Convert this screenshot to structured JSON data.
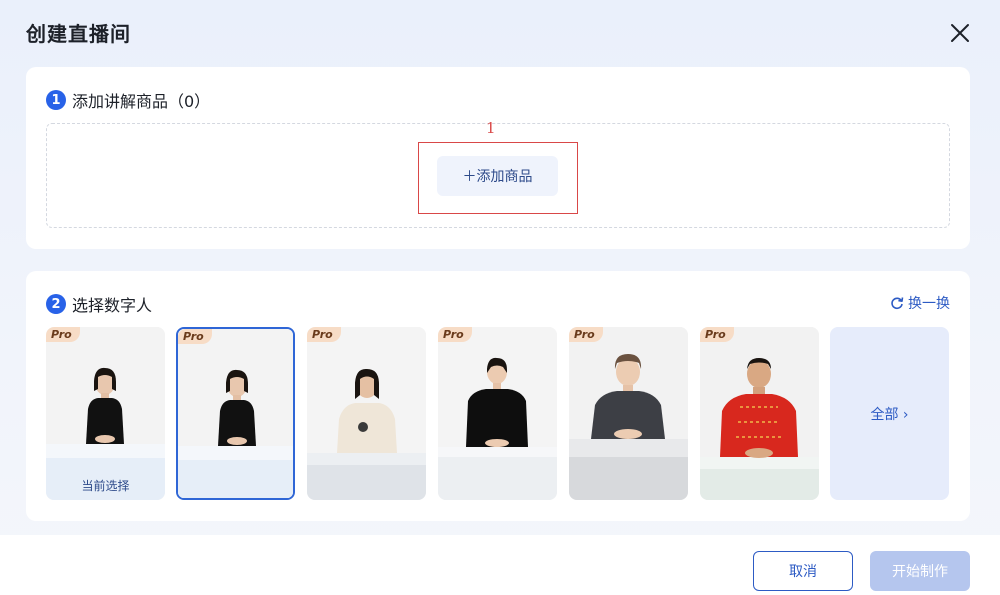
{
  "dialog": {
    "title": "创建直播间",
    "close_icon": "close-icon"
  },
  "section1": {
    "number": "1",
    "title": "添加讲解商品（0）",
    "add_button": "＋添加商品",
    "annotation_number": "1",
    "annotation_color": "#d94848"
  },
  "section2": {
    "number": "2",
    "title": "选择数字人",
    "swap_label": "换一换",
    "swap_icon": "refresh-icon",
    "all_label": "全部 ›",
    "avatars": [
      {
        "badge": "Pro",
        "caption": "当前选择",
        "outfit": "black-blouse-woman"
      },
      {
        "badge": "Pro",
        "caption": "",
        "outfit": "black-blouse-woman",
        "selected": true
      },
      {
        "badge": "Pro",
        "caption": "",
        "outfit": "cream-sweater-woman"
      },
      {
        "badge": "Pro",
        "caption": "",
        "outfit": "black-tshirt-woman"
      },
      {
        "badge": "Pro",
        "caption": "",
        "outfit": "grey-tshirt-man"
      },
      {
        "badge": "Pro",
        "caption": "",
        "outfit": "red-tangzhuang-man"
      }
    ]
  },
  "footer": {
    "cancel_label": "取消",
    "start_label": "开始制作"
  },
  "colors": {
    "accent": "#2862e8",
    "link": "#2d5bc4",
    "disabled_button": "#b5c6ee",
    "pro_badge": "#f7dcc6"
  }
}
